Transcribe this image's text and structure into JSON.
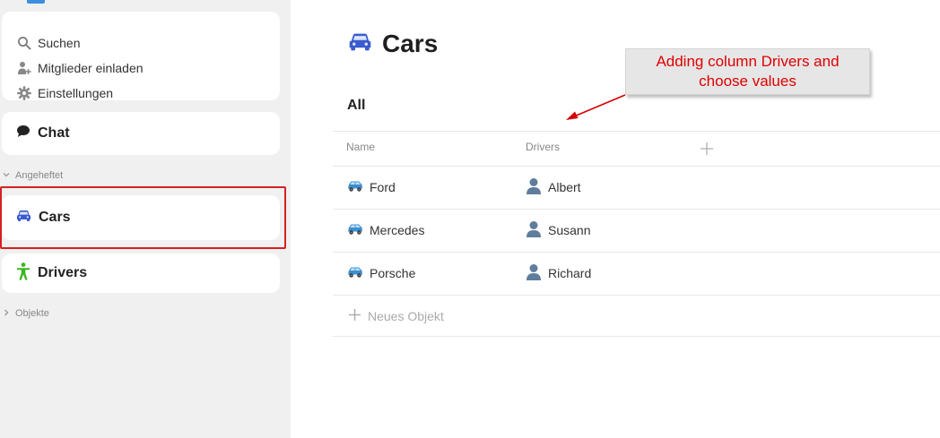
{
  "sidebar": {
    "menu": [
      {
        "label": "Suchen",
        "icon": "search-icon"
      },
      {
        "label": "Mitglieder einladen",
        "icon": "invite-members-icon"
      },
      {
        "label": "Einstellungen",
        "icon": "gear-icon"
      }
    ],
    "chat_label": "Chat",
    "pinned_label": "Angeheftet",
    "pinned_items": [
      {
        "label": "Cars",
        "icon": "car-icon"
      },
      {
        "label": "Drivers",
        "icon": "accessibility-person-icon"
      }
    ],
    "objects_label": "Objekte"
  },
  "main": {
    "title": "Cars",
    "view_tab": "All",
    "columns": [
      "Name",
      "Drivers"
    ],
    "rows": [
      {
        "name": "Ford",
        "driver": "Albert"
      },
      {
        "name": "Mercedes",
        "driver": "Susann"
      },
      {
        "name": "Porsche",
        "driver": "Richard"
      }
    ],
    "new_object_label": "Neues Objekt"
  },
  "annotation": {
    "line1": "Adding column Drivers and",
    "line2": "choose values"
  },
  "colors": {
    "accent_blue": "#3a5ccc",
    "drivers_green": "#3cb521",
    "annotation_red": "#e10000",
    "highlight_red": "#d42121"
  }
}
